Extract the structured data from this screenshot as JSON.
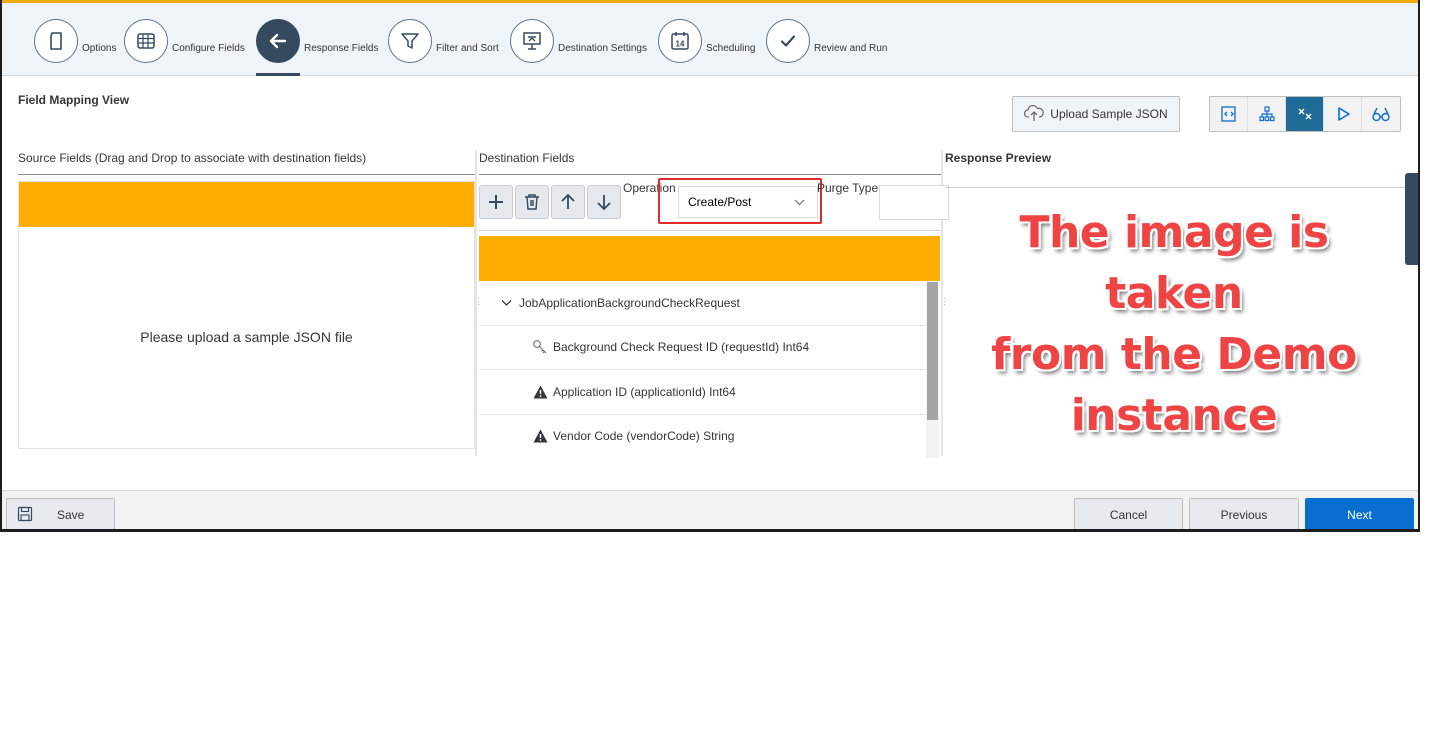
{
  "wizard": {
    "steps": [
      {
        "label": "Options",
        "icon": "document-icon"
      },
      {
        "label": "Configure Fields",
        "icon": "table-grid-icon"
      },
      {
        "label": "Response Fields",
        "icon": "arrow-left-icon",
        "active": true
      },
      {
        "label": "Filter and Sort",
        "icon": "filter-icon"
      },
      {
        "label": "Destination Settings",
        "icon": "presentation-icon"
      },
      {
        "label": "Scheduling",
        "icon": "calendar-icon",
        "icon_text": "14"
      },
      {
        "label": "Review and Run",
        "icon": "checkmark-icon"
      }
    ]
  },
  "page": {
    "section_title": "Field Mapping View",
    "upload_button": "Upload Sample JSON",
    "view_modes": [
      "code-view-icon",
      "hierarchy-icon",
      "mapping-icon",
      "run-icon",
      "preview-icon"
    ],
    "active_view_mode": "mapping-icon"
  },
  "source": {
    "header": "Source Fields (Drag and Drop to associate with destination fields)",
    "empty_message": "Please upload a sample JSON file"
  },
  "destination": {
    "header": "Destination Fields",
    "operation_label": "Operation",
    "operation_value": "Create/Post",
    "purge_label": "Purge Type",
    "purge_value": "",
    "tree": [
      {
        "label": "JobApplicationBackgroundCheckRequest",
        "icon": "chevron-down-icon",
        "level": 0
      },
      {
        "label": "Background Check Request ID (requestId) Int64",
        "icon": "key-icon",
        "level": 1
      },
      {
        "label": "Application ID (applicationId) Int64",
        "icon": "warning-icon",
        "level": 1
      },
      {
        "label": "Vendor Code (vendorCode) String",
        "icon": "warning-icon",
        "level": 1
      }
    ]
  },
  "response": {
    "header": "Response Preview"
  },
  "watermark": {
    "lines": [
      "The image is taken",
      "from the Demo",
      "instance"
    ]
  },
  "footer": {
    "save": "Save",
    "cancel": "Cancel",
    "previous": "Previous",
    "next": "Next"
  },
  "colors": {
    "accent_orange": "#ffad00",
    "primary_blue": "#0a6ed1",
    "step_active": "#354a5f",
    "highlight_red": "#e02b2b",
    "watermark_red": "#ef4444"
  }
}
